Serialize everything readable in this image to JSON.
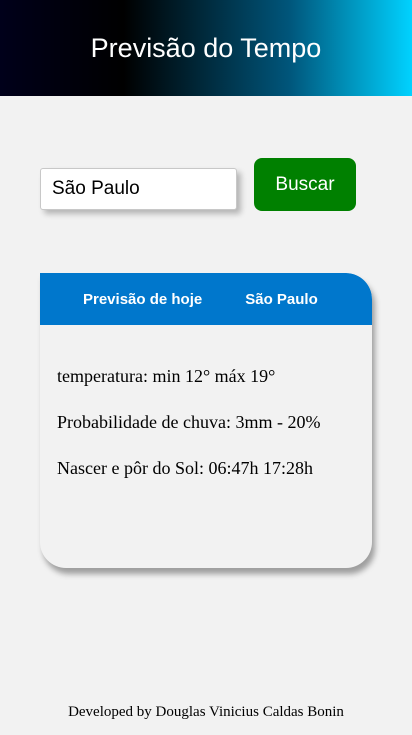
{
  "header": {
    "title": "Previsão do Tempo"
  },
  "search": {
    "value": "São Paulo",
    "button_label": "Buscar"
  },
  "forecast": {
    "title": "Previsão de hoje",
    "city": "São Paulo",
    "temperature": "temperatura: min 12° máx 19°",
    "rain": "Probabilidade de chuva: 3mm - 20%",
    "sun": "Nascer e pôr do Sol: 06:47h 17:28h"
  },
  "footer": {
    "credit": "Developed by Douglas Vinicius Caldas Bonin"
  },
  "colors": {
    "search_button": "#008000",
    "card_header": "#0077cc"
  }
}
